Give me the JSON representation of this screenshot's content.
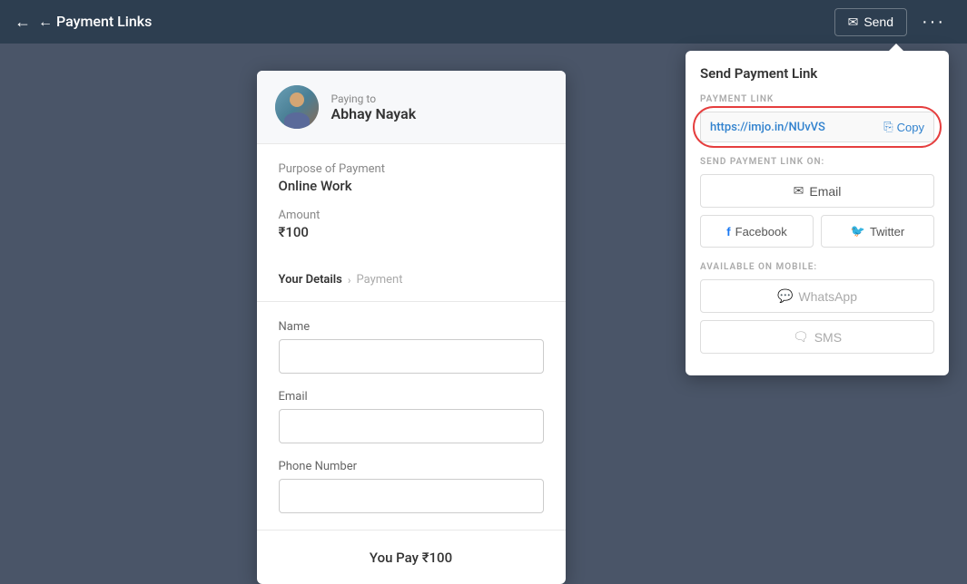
{
  "header": {
    "back_label": "← Payment Links",
    "send_label": "Send",
    "more_label": "···"
  },
  "payee": {
    "paying_to": "Paying to",
    "name": "Abhay Nayak"
  },
  "payment": {
    "purpose_label": "Purpose of Payment",
    "purpose_value": "Online Work",
    "amount_label": "Amount",
    "amount_value": "₹100"
  },
  "steps": {
    "step1": "Your Details",
    "chevron": "›",
    "step2": "Payment"
  },
  "form": {
    "name_label": "Name",
    "name_placeholder": "",
    "email_label": "Email",
    "email_placeholder": "",
    "phone_label": "Phone Number",
    "phone_placeholder": ""
  },
  "footer": {
    "you_pay": "You Pay ₹100"
  },
  "send_panel": {
    "title": "Send Payment Link",
    "payment_link_label": "PAYMENT LINK",
    "link_url": "https://imjo.in/NUvVS",
    "copy_label": "Copy",
    "send_on_label": "SEND PAYMENT LINK ON:",
    "email_btn": "Email",
    "facebook_btn": "Facebook",
    "twitter_btn": "Twitter",
    "mobile_label": "AVAILABLE ON MOBILE:",
    "whatsapp_btn": "WhatsApp",
    "sms_btn": "SMS"
  }
}
